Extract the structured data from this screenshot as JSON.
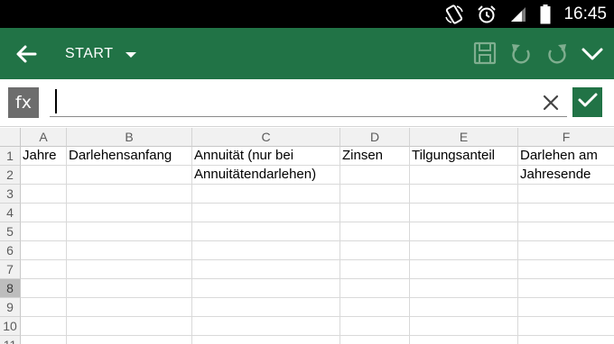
{
  "status_bar": {
    "time": "16:45",
    "icons": [
      "rotate-lock-icon",
      "alarm-icon",
      "signal-icon",
      "battery-icon"
    ]
  },
  "toolbar": {
    "menu_label": "START",
    "icons": [
      "back-arrow-icon",
      "save-icon",
      "undo-icon",
      "redo-icon",
      "collapse-chevron-icon"
    ],
    "color": "#217346"
  },
  "formula_bar": {
    "fx_label": "fx",
    "value": "",
    "confirm_color": "#217346"
  },
  "sheet": {
    "columns": [
      "A",
      "B",
      "C",
      "D",
      "E",
      "F"
    ],
    "rows": [
      "1",
      "2",
      "3",
      "4",
      "5",
      "6",
      "7",
      "8",
      "9",
      "10",
      "11"
    ],
    "selected_row": "8",
    "cells": {
      "A1": "Jahre",
      "B1": "Darlehensanfang",
      "C1": "Annuität (nur bei",
      "C2": "Annuitätendarlehen)",
      "D1": "Zinsen",
      "E1": "Tilgungsanteil",
      "F1": "Darlehen am",
      "F2": "Jahresende"
    }
  }
}
